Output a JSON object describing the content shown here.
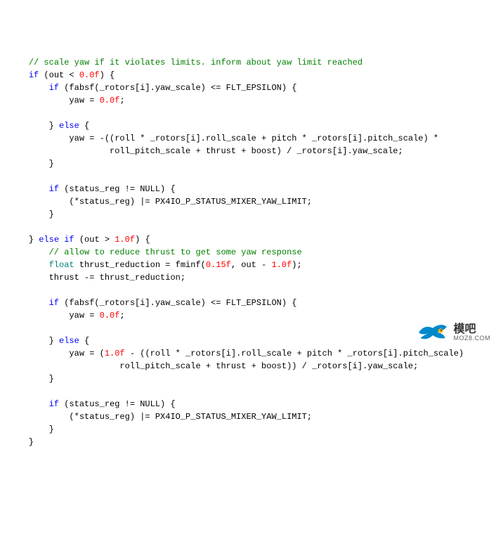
{
  "code": {
    "c1": "// scale yaw if it violates limits. inform about yaw limit reached",
    "c2": "// allow to reduce thrust to get some yaw response",
    "kw_if": "if",
    "kw_else": "else",
    "kw_elseif": "else if",
    "kw_float": "float",
    "id_out": "out",
    "id_fabsf": "fabsf",
    "id_rotors": "_rotors",
    "id_i": "i",
    "id_yaw_scale": "yaw_scale",
    "id_roll_scale": "roll_scale",
    "id_pitch_scale": "pitch_scale",
    "id_flt_eps": "FLT_EPSILON",
    "id_yaw": "yaw",
    "id_roll": "roll",
    "id_pitch": "pitch",
    "id_roll_pitch_scale": "roll_pitch_scale",
    "id_thrust": "thrust",
    "id_boost": "boost",
    "id_status_reg": "status_reg",
    "id_null": "NULL",
    "id_px4": "PX4IO_P_STATUS_MIXER_YAW_LIMIT",
    "id_thrust_red": "thrust_reduction",
    "id_fminf": "fminf",
    "n_00f": "0.0f",
    "n_10f": "1.0f",
    "n_015f": "0.15f"
  },
  "logo": {
    "name_cn": "模吧",
    "url": "MOZ8.COM"
  }
}
